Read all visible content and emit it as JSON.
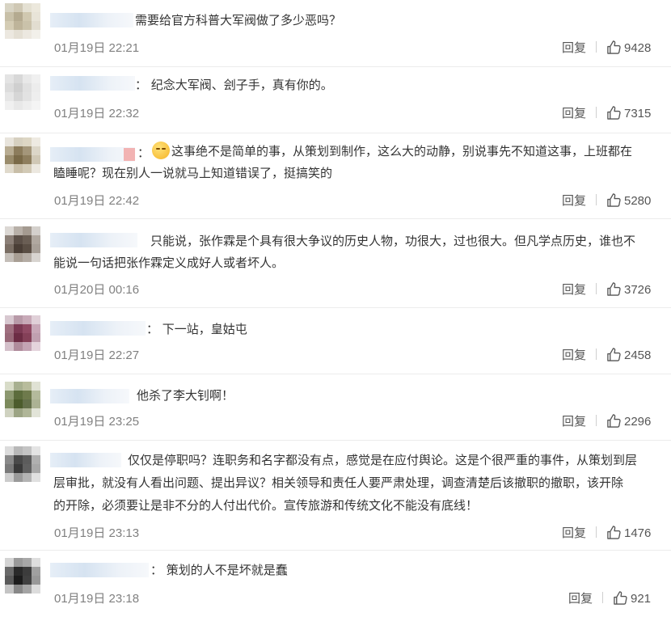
{
  "comments": [
    {
      "text": "需要给官方科普大军阀做了多少恶吗？",
      "time": "01月19日 22:21",
      "reply_label": "回复",
      "likes": "9428",
      "avatar_colors": [
        "#d8d4c4",
        "#cfc8b4",
        "#e4e0d2",
        "#ece8dc",
        "#c8c0a8",
        "#b4aa90",
        "#d0c8b0",
        "#e8e4d8",
        "#d4ccb4",
        "#beb49a",
        "#cac2aa",
        "#e2ddd0",
        "#ece8e0",
        "#e4dfd4",
        "#ece8e0",
        "#f2f0ea"
      ]
    },
    {
      "text": "：  纪念大军阀、刽子手，真有你的。",
      "time": "01月19日 22:32",
      "reply_label": "回复",
      "likes": "7315",
      "avatar_colors": [
        "#e4e4e4",
        "#d8d8d8",
        "#e8e8e8",
        "#f0f0f0",
        "#dcdcdc",
        "#cfcfcf",
        "#e0e0e0",
        "#ececec",
        "#e6e6e6",
        "#d6d6d6",
        "#e2e2e2",
        "#eeeeee",
        "#f0f0f0",
        "#e8e8e8",
        "#eeeeee",
        "#f4f4f4"
      ]
    },
    {
      "text": "这事绝不是简单的事，从策划到制作，这么大的动静，别说事先不知道这事，上班都在",
      "text2": "瞌睡呢？现在别人一说就马上知道错误了，挺搞笑的",
      "time": "01月19日 22:42",
      "reply_label": "回复",
      "likes": "5280",
      "avatar_colors": [
        "#e8e4dc",
        "#d6d0c0",
        "#ddd6c4",
        "#eeeae2",
        "#b8ac92",
        "#8c7c5c",
        "#a4967a",
        "#dcd6c8",
        "#9a8c6c",
        "#7a6a48",
        "#8e7e5e",
        "#d0c8b6",
        "#e0dacc",
        "#c8bea8",
        "#d2cab6",
        "#ece8e0"
      ]
    },
    {
      "text": "只能说，张作霖是个具有很大争议的历史人物，功很大，过也很大。但凡学点历史，谁也不",
      "text2": "能说一句话把张作霖定义成好人或者坏人。",
      "time": "01月20日 00:16",
      "reply_label": "回复",
      "likes": "3726",
      "avatar_colors": [
        "#dcd8d4",
        "#b8b0a8",
        "#a49a90",
        "#d4d0cc",
        "#8c8078",
        "#5c5048",
        "#6a5e54",
        "#b0a8a0",
        "#7a6e64",
        "#4a3e36",
        "#5a4e44",
        "#a8a098",
        "#c4beb8",
        "#a89e94",
        "#b4aca4",
        "#d8d4d0"
      ]
    },
    {
      "text": "：  下一站，皇姑屯",
      "time": "01月19日 22:27",
      "reply_label": "回复",
      "likes": "2458",
      "avatar_colors": [
        "#d8c8d0",
        "#b89aa8",
        "#c8aab8",
        "#e0d0d8",
        "#a07080",
        "#7c3a54",
        "#904a64",
        "#c8a8b8",
        "#986878",
        "#6c2c44",
        "#844058",
        "#c0a0b0",
        "#d4c0ca",
        "#b08c9c",
        "#c4a4b4",
        "#e4d4dc"
      ]
    },
    {
      "text": "他杀了李大钊啊！",
      "time": "01月19日 23:25",
      "reply_label": "回复",
      "likes": "2296",
      "avatar_colors": [
        "#d8dcc8",
        "#a8b090",
        "#b8bc9c",
        "#e0e2d4",
        "#8c9870",
        "#5c6c3c",
        "#6e7a4c",
        "#b4ba9c",
        "#7c8a5c",
        "#4c5c2c",
        "#64704a",
        "#acb294",
        "#cfd2c0",
        "#9ca484",
        "#b0b698",
        "#e2e4d8"
      ]
    },
    {
      "text": "仅仅是停职吗？连职务和名字都没有点，感觉是在应付舆论。这是个很严重的事件，从策划到层",
      "text2": "层审批，就没有人看出问题、提出异议？相关领导和责任人要严肃处理，调查清楚后该撤职的撤职，该开除",
      "text3": "的开除，必须要让是非不分的人付出代价。宣传旅游和传统文化不能没有底线！",
      "time": "01月19日 23:13",
      "reply_label": "回复",
      "likes": "1476",
      "avatar_colors": [
        "#dcdcdc",
        "#b8b8b8",
        "#c4c4c4",
        "#e4e4e4",
        "#8a8a8a",
        "#4a4a4a",
        "#5c5c5c",
        "#b0b0b0",
        "#7a7a7a",
        "#3a3a3a",
        "#606060",
        "#a8a8a8",
        "#cccccc",
        "#9a9a9a",
        "#b4b4b4",
        "#e0e0e0"
      ]
    },
    {
      "text": "：  策划的人不是坏就是蠢",
      "time": "01月19日 23:18",
      "reply_label": "回复",
      "likes": "921",
      "avatar_colors": [
        "#d4d4d4",
        "#9a9a9a",
        "#a8a8a8",
        "#dedede",
        "#6a6a6a",
        "#2a2a2a",
        "#3c3c3c",
        "#a0a0a0",
        "#5a5a5a",
        "#1c1c1c",
        "#404040",
        "#989898",
        "#c4c4c4",
        "#888888",
        "#a4a4a4",
        "#dcdcdc"
      ]
    }
  ]
}
